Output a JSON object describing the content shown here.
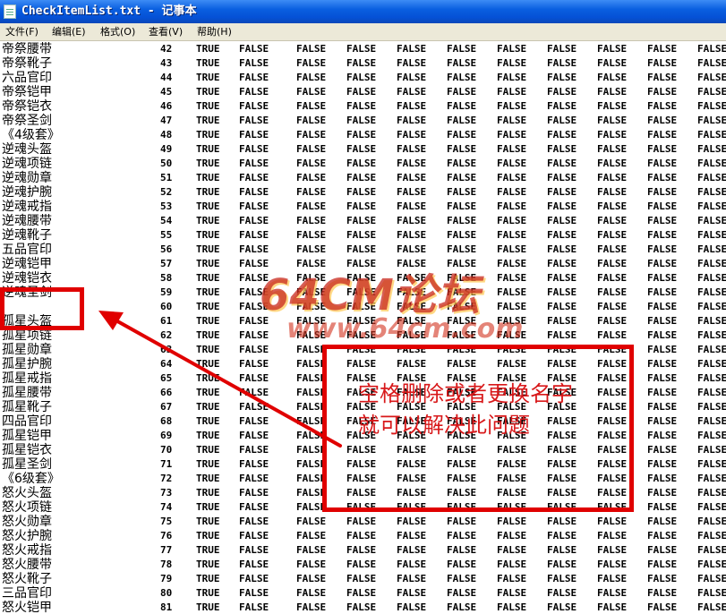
{
  "window": {
    "title": "CheckItemList.txt - 记事本",
    "menu": [
      "文件(F)",
      "编辑(E)",
      "格式(O)",
      "查看(V)",
      "帮助(H)"
    ]
  },
  "rows": [
    {
      "name": "帝祭腰带",
      "num": "42"
    },
    {
      "name": "帝祭靴子",
      "num": "43"
    },
    {
      "name": "六品官印",
      "num": "44"
    },
    {
      "name": "帝祭铠甲",
      "num": "45"
    },
    {
      "name": "帝祭铠衣",
      "num": "46"
    },
    {
      "name": "帝祭圣剑",
      "num": "47"
    },
    {
      "name": "《4级套》",
      "num": "48"
    },
    {
      "name": "逆魂头盔",
      "num": "49"
    },
    {
      "name": "逆魂项链",
      "num": "50"
    },
    {
      "name": "逆魂勋章",
      "num": "51"
    },
    {
      "name": "逆魂护腕",
      "num": "52"
    },
    {
      "name": "逆魂戒指",
      "num": "53"
    },
    {
      "name": "逆魂腰带",
      "num": "54"
    },
    {
      "name": "逆魂靴子",
      "num": "55"
    },
    {
      "name": "五品官印",
      "num": "56"
    },
    {
      "name": "逆魂铠甲",
      "num": "57"
    },
    {
      "name": "逆魂铠衣",
      "num": "58"
    },
    {
      "name": "逆魂圣剑",
      "num": "59"
    },
    {
      "name": "",
      "num": "60"
    },
    {
      "name": "孤星头盔",
      "num": "61"
    },
    {
      "name": "孤星项链",
      "num": "62"
    },
    {
      "name": "孤星勋章",
      "num": "63"
    },
    {
      "name": "孤星护腕",
      "num": "64"
    },
    {
      "name": "孤星戒指",
      "num": "65"
    },
    {
      "name": "孤星腰带",
      "num": "66"
    },
    {
      "name": "孤星靴子",
      "num": "67"
    },
    {
      "name": "四品官印",
      "num": "68"
    },
    {
      "name": "孤星铠甲",
      "num": "69"
    },
    {
      "name": "孤星铠衣",
      "num": "70"
    },
    {
      "name": "孤星圣剑",
      "num": "71"
    },
    {
      "name": "《6级套》",
      "num": "72"
    },
    {
      "name": "怒火头盔",
      "num": "73"
    },
    {
      "name": "怒火项链",
      "num": "74"
    },
    {
      "name": "怒火勋章",
      "num": "75"
    },
    {
      "name": "怒火护腕",
      "num": "76"
    },
    {
      "name": "怒火戒指",
      "num": "77"
    },
    {
      "name": "怒火腰带",
      "num": "78"
    },
    {
      "name": "怒火靴子",
      "num": "79"
    },
    {
      "name": "三品官印",
      "num": "80"
    },
    {
      "name": "怒火铠甲",
      "num": "81"
    }
  ],
  "row_values": [
    "TRUE",
    "FALSE",
    "FALSE",
    "FALSE",
    "FALSE",
    "FALSE",
    "FALSE",
    "FALSE",
    "FALSE",
    "FALSE",
    "FALSE"
  ],
  "annotation": {
    "note_line1": "空格删除或者更换名字",
    "note_line2": "就可以解决此问题",
    "color": "#e00000"
  },
  "watermark": {
    "text": "64CM论坛",
    "url": "www.64cm.com"
  }
}
